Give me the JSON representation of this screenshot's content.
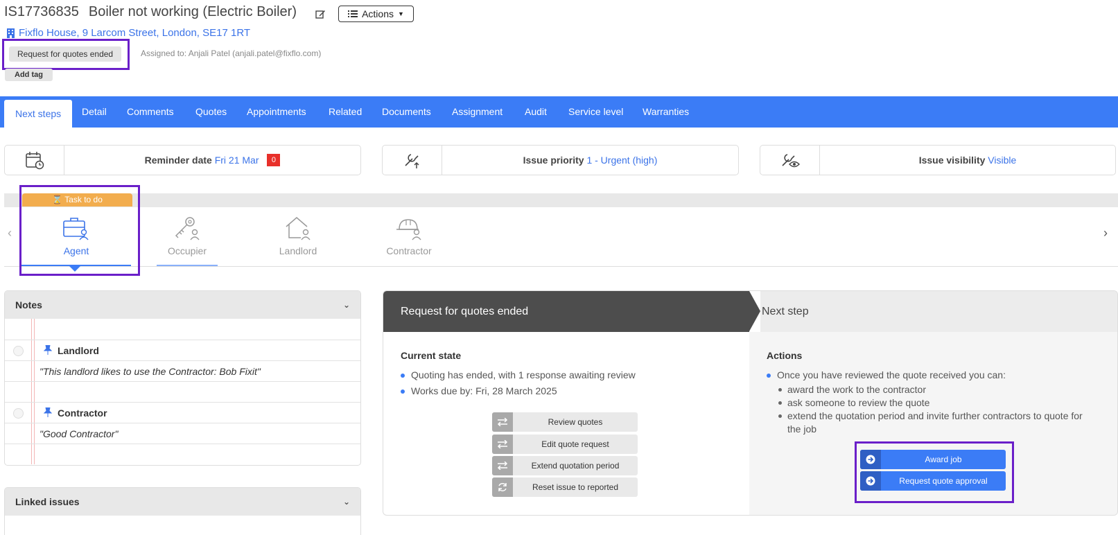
{
  "header": {
    "ref": "IS17736835",
    "title": "Boiler not working (Electric Boiler)",
    "actions_label": "Actions",
    "address": "Fixflo House, 9 Larcom Street, London, SE17 1RT",
    "status": "Request for quotes ended",
    "assigned": "Assigned to: Anjali Patel (anjali.patel@fixflo.com)",
    "add_tag": "Add tag"
  },
  "tabs": [
    "Next steps",
    "Detail",
    "Comments",
    "Quotes",
    "Appointments",
    "Related",
    "Documents",
    "Assignment",
    "Audit",
    "Service level",
    "Warranties"
  ],
  "cards": {
    "reminder": {
      "label": "Reminder date",
      "value": "Fri 21 Mar",
      "badge": "0"
    },
    "priority": {
      "label": "Issue priority",
      "value": "1 - Urgent (high)"
    },
    "visibility": {
      "label": "Issue visibility",
      "value": "Visible"
    }
  },
  "stakeholders": {
    "task_tag": "Task to do",
    "items": [
      "Agent",
      "Occupier",
      "Landlord",
      "Contractor"
    ]
  },
  "notes": {
    "title": "Notes",
    "items": [
      {
        "who": "Landlord",
        "text": "\"This landlord likes to use the Contractor: Bob Fixit\""
      },
      {
        "who": "Contractor",
        "text": "\"Good Contractor\""
      }
    ]
  },
  "linked": {
    "title": "Linked issues"
  },
  "workflow": {
    "state_title": "Request for quotes ended",
    "next_title": "Next step",
    "current_state_h": "Current state",
    "current_state": [
      "Quoting has ended, with 1 response awaiting review",
      "Works due by: Fri, 28 March 2025"
    ],
    "buttons": [
      "Review quotes",
      "Edit quote request",
      "Extend quotation period",
      "Reset issue to reported"
    ],
    "actions_h": "Actions",
    "actions_intro": "Once you have reviewed the quote received you can:",
    "actions_sub": [
      "award the work to the contractor",
      "ask someone to review the quote",
      "extend the quotation period and invite further contractors to quote for",
      "the job"
    ],
    "primary": [
      "Award job",
      "Request quote approval"
    ]
  },
  "colors": {
    "accent": "#3b7cf6",
    "highlight": "#6a1fc9",
    "task": "#f2ad4e",
    "badge": "#e8302a"
  }
}
